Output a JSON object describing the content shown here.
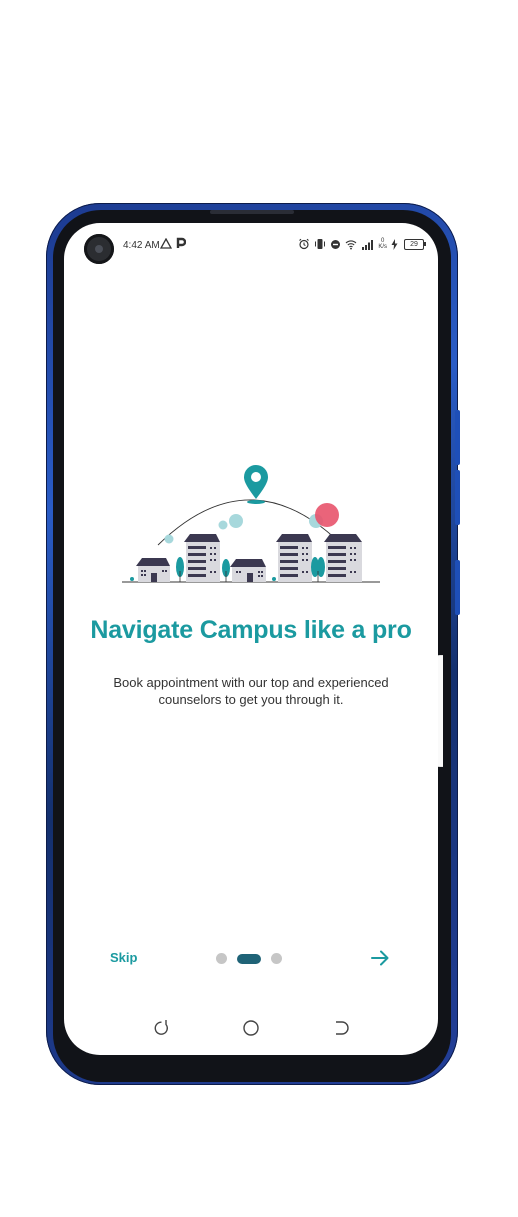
{
  "status_bar": {
    "time": "4:42 AM",
    "left_icons": [
      "warning-triangle-icon",
      "p-app-icon"
    ],
    "right_icons": [
      "alarm-icon",
      "vibrate-icon",
      "dnd-icon",
      "wifi-icon",
      "signal-icon"
    ],
    "net_speed_value": "0",
    "net_speed_unit": "K/s",
    "battery_level": "29"
  },
  "onboarding": {
    "title": "Navigate Campus like a pro",
    "subtitle": "Book appointment with our top and experienced counselors to get you through it.",
    "skip_label": "Skip",
    "page_count": 3,
    "active_page": 2
  },
  "colors": {
    "accent": "#1b9aa0",
    "indicator_active": "#1f6377",
    "indicator_inactive": "#c6c6c6",
    "building": "#d9d9de",
    "building_dark": "#3b3850",
    "pin": "#1b9aa0",
    "sun": "#e8536b"
  },
  "system_nav": [
    "recents-icon",
    "home-icon",
    "back-icon"
  ]
}
